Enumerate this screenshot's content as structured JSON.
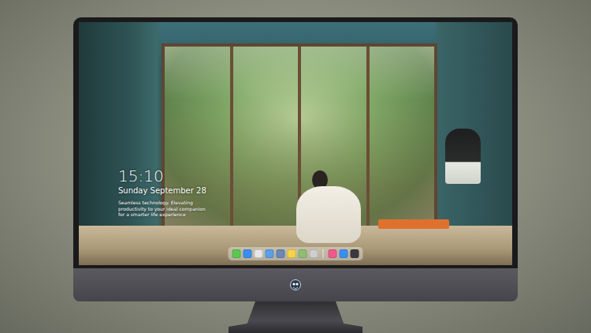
{
  "lock_screen": {
    "time": "15:10",
    "date": "Sunday September 28",
    "tagline": "Seamless technology. Elevating productivity to your ideal companion for a smarter life experience"
  },
  "dock": {
    "apps": [
      {
        "kind": "app",
        "color": "#5cc852"
      },
      {
        "kind": "app",
        "color": "#3b8ef0"
      },
      {
        "kind": "app",
        "color": "#e6e6e6"
      },
      {
        "kind": "app",
        "color": "#5aa0e8"
      },
      {
        "kind": "app",
        "color": "#6a88b8"
      },
      {
        "kind": "app",
        "color": "#f5d547"
      },
      {
        "kind": "app",
        "color": "#8fbf73"
      },
      {
        "kind": "app",
        "color": "#cfcfcf"
      },
      {
        "kind": "divider",
        "color": "#ffffff"
      },
      {
        "kind": "app",
        "color": "#f05b8c"
      },
      {
        "kind": "app",
        "color": "#3d8fef"
      },
      {
        "kind": "app",
        "color": "#3a3a3e"
      }
    ]
  }
}
